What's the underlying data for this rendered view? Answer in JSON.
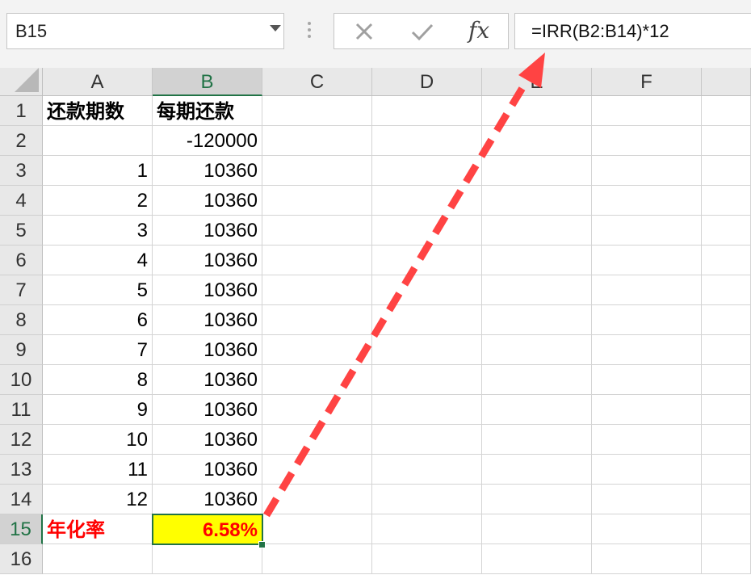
{
  "formula_bar": {
    "name_box": "B15",
    "cancel_icon": "x-icon",
    "enter_icon": "check-icon",
    "fx_label": "fx",
    "formula": "=IRR(B2:B14)*12"
  },
  "columns": [
    "A",
    "B",
    "C",
    "D",
    "E",
    "F"
  ],
  "rows": [
    "1",
    "2",
    "3",
    "4",
    "5",
    "6",
    "7",
    "8",
    "9",
    "10",
    "11",
    "12",
    "13",
    "14",
    "15",
    "16"
  ],
  "cells": {
    "A1": "还款期数",
    "B1": "每期还款",
    "A2": "",
    "B2": "-120000",
    "A3": "1",
    "B3": "10360",
    "A4": "2",
    "B4": "10360",
    "A5": "3",
    "B5": "10360",
    "A6": "4",
    "B6": "10360",
    "A7": "5",
    "B7": "10360",
    "A8": "6",
    "B8": "10360",
    "A9": "7",
    "B9": "10360",
    "A10": "8",
    "B10": "10360",
    "A11": "9",
    "B11": "10360",
    "A12": "10",
    "B12": "10360",
    "A13": "11",
    "B13": "10360",
    "A14": "12",
    "B14": "10360",
    "A15": "年化率",
    "B15": "6.58%"
  },
  "colors": {
    "accent": "#217346",
    "highlight": "#ffff00",
    "label_red": "#ff0000",
    "arrow": "#ff4040"
  },
  "annotation": {
    "arrow": "red dashed arrow from B15 to formula bar"
  }
}
